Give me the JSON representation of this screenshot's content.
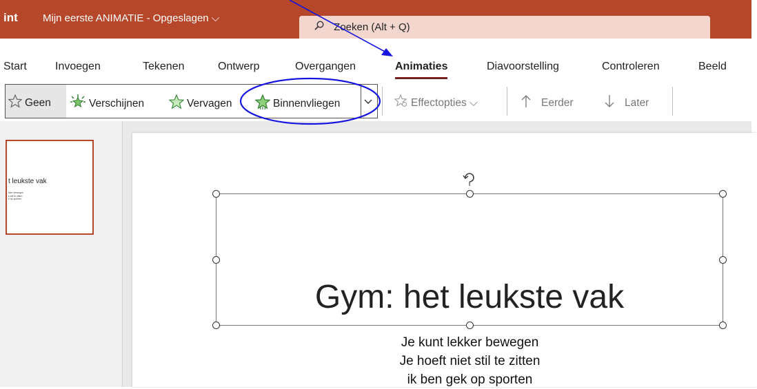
{
  "titlebar": {
    "app_name": "int",
    "doc_title": "Mijn eerste ANIMATIE - Opgeslagen ⌵",
    "search_icon": "search-icon",
    "search_label": "Zoeken (Alt + Q)"
  },
  "tabs": [
    {
      "label": "Start"
    },
    {
      "label": "Invoegen"
    },
    {
      "label": "Tekenen"
    },
    {
      "label": "Ontwerp"
    },
    {
      "label": "Overgangen"
    },
    {
      "label": "Animaties",
      "active": true
    },
    {
      "label": "Diavoorstelling"
    },
    {
      "label": "Controleren"
    },
    {
      "label": "Beeld"
    }
  ],
  "ribbon": {
    "gallery": [
      {
        "label": "Geen",
        "icon": "star-outline-icon",
        "selected": true
      },
      {
        "label": "Verschijnen",
        "icon": "star-burst-icon"
      },
      {
        "label": "Vervagen",
        "icon": "star-fade-icon"
      },
      {
        "label": "Binnenvliegen",
        "icon": "star-fly-in-icon"
      }
    ],
    "effect_options": "Effectopties ⌵",
    "earlier": "Eerder",
    "later": "Later"
  },
  "thumbnail": {
    "title": "t leukste vak",
    "body": [
      "kker bewegen",
      "e stil te zitten",
      "k op sporten"
    ]
  },
  "slide": {
    "title": "Gym: het leukste vak",
    "body": [
      "Je kunt lekker bewegen",
      "Je hoeft niet stil te zitten",
      "ik ben gek op sporten"
    ]
  },
  "colors": {
    "brand": "#b7472a",
    "search_bg": "#f3d7ce",
    "annotation": "#1515e0",
    "active_underline": "#7a1f1f"
  }
}
